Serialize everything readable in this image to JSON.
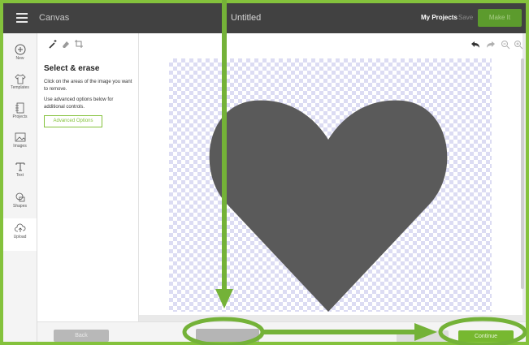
{
  "header": {
    "app_name": "Canvas",
    "doc_title": "Untitled",
    "my_projects": "My Projects",
    "save": "Save",
    "make_it": "Make It"
  },
  "sidebar": {
    "items": [
      {
        "label": "New",
        "icon": "plus-circle-icon"
      },
      {
        "label": "Templates",
        "icon": "tshirt-icon"
      },
      {
        "label": "Projects",
        "icon": "projects-icon"
      },
      {
        "label": "Images",
        "icon": "image-icon"
      },
      {
        "label": "Text",
        "icon": "text-icon"
      },
      {
        "label": "Shapes",
        "icon": "shapes-icon"
      },
      {
        "label": "Upload",
        "icon": "upload-cloud-icon"
      }
    ]
  },
  "panel": {
    "title": "Select & erase",
    "desc1": "Click on the areas of the image you want to remove.",
    "desc2": "Use advanced options below for additional controls.",
    "advanced_options": "Advanced Options",
    "tools": [
      "magic-wand-icon",
      "eraser-icon",
      "crop-icon"
    ]
  },
  "canvas_toolbar": {
    "tools": [
      "undo-icon",
      "redo-icon",
      "zoom-out-icon",
      "zoom-in-icon"
    ]
  },
  "footer": {
    "back": "Back",
    "continue": "Continue"
  },
  "colors": {
    "accent_green": "#84c23c",
    "topbar": "#414141",
    "heart": "#5a5a5a"
  }
}
